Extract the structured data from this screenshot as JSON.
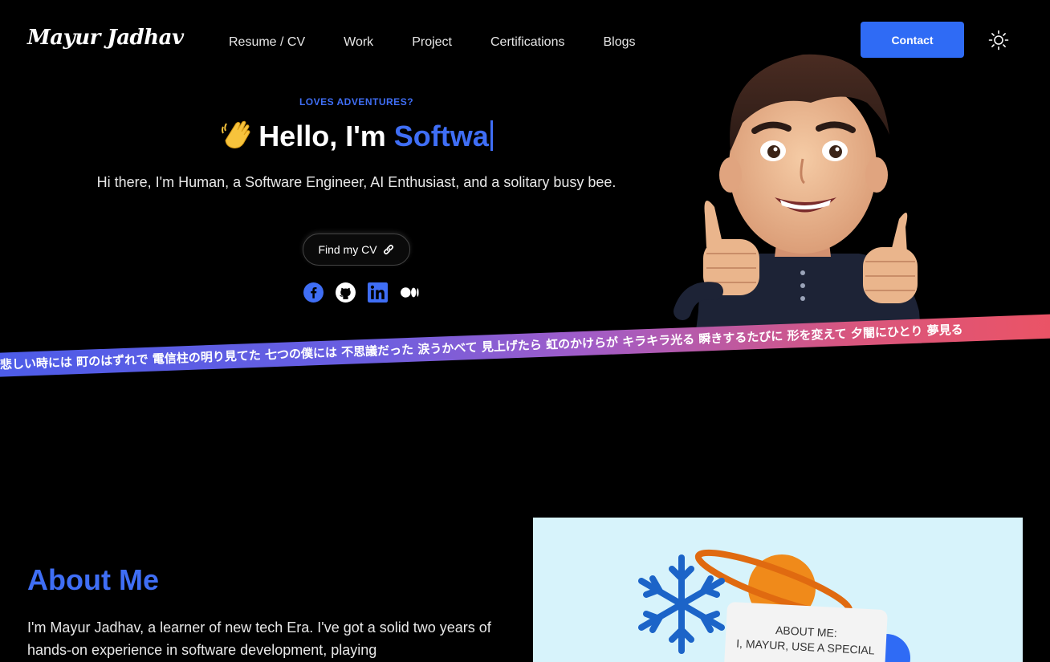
{
  "header": {
    "logo": "Mayur Jadhav",
    "nav": [
      "Resume / CV",
      "Work",
      "Project",
      "Certifications",
      "Blogs"
    ],
    "contact_label": "Contact",
    "theme_icon": "sun-icon"
  },
  "hero": {
    "eyebrow": "LOVES ADVENTURES?",
    "greeting": "Hello, I'm",
    "typed": "Softwa",
    "subtitle": "Hi there, I'm Human, a Software Engineer, AI Enthusiast, and a solitary busy bee.",
    "cv_label": "Find my CV",
    "socials": [
      "facebook-icon",
      "github-icon",
      "linkedin-icon",
      "medium-icon"
    ]
  },
  "marquee": {
    "text": "悲しい時には 町のはずれで 電信柱の明り見てた 七つの僕には 不思議だった 涙うかべて 見上げたら 虹のかけらが キラキラ光る 瞬きするたびに 形を変えて 夕闇にひとり 夢見る"
  },
  "about": {
    "title": "About Me",
    "text": "I'm Mayur Jadhav, a learner of new tech Era. I've got a solid two years of hands-on experience in software development, playing",
    "card_heading": "ABOUT ME:",
    "card_line": "I, MAYUR, USE A SPECIAL"
  },
  "colors": {
    "accent": "#3f6ef5",
    "background": "#000000",
    "button": "#2f6bf5"
  }
}
